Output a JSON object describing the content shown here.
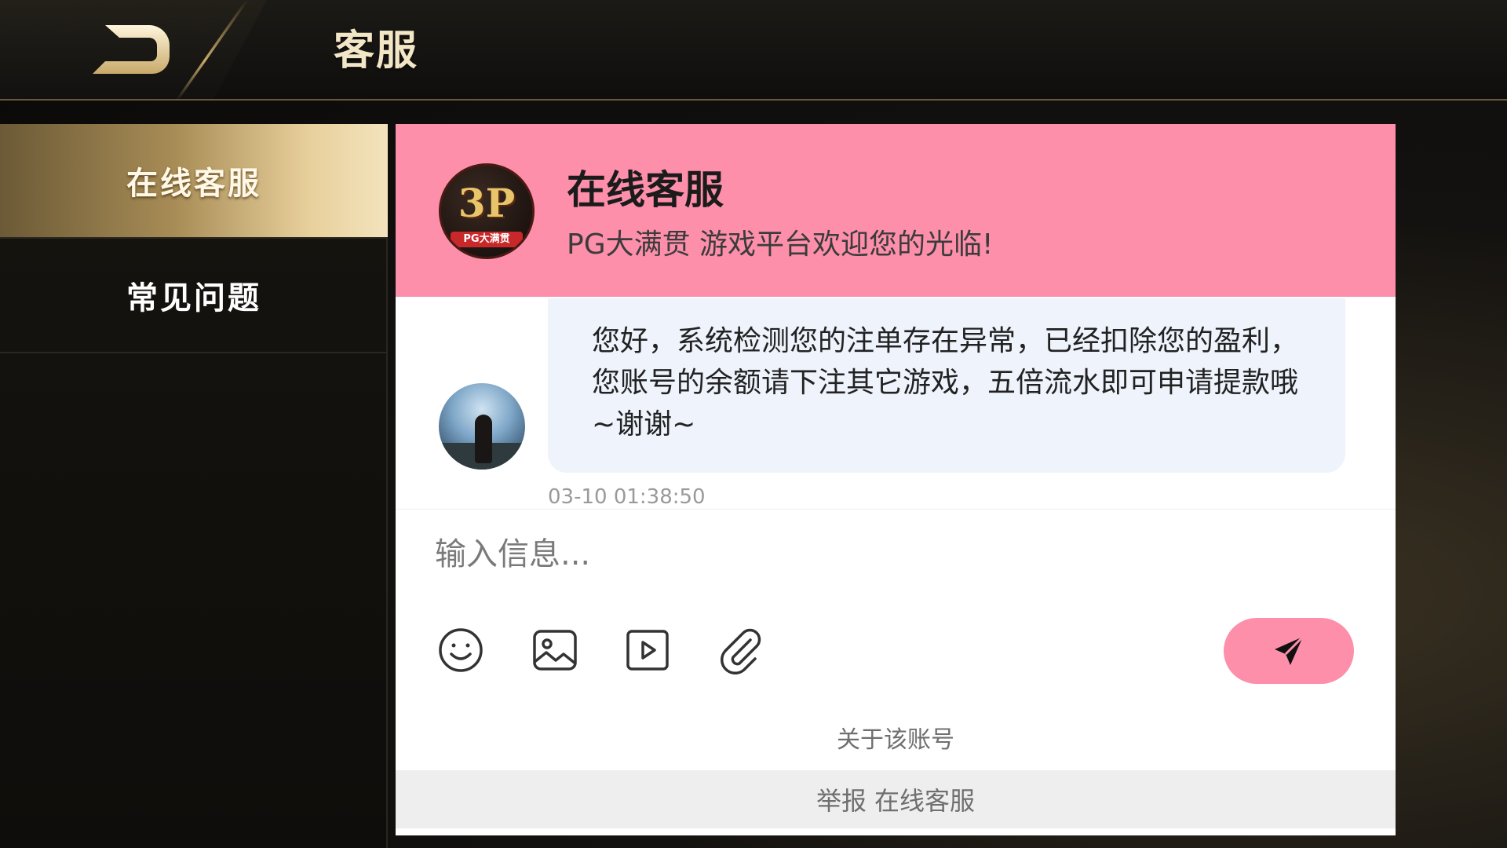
{
  "header": {
    "title": "客服",
    "back_icon": "back-arrow-icon"
  },
  "sidebar": {
    "items": [
      {
        "label": "在线客服",
        "active": true
      },
      {
        "label": "常见问题",
        "active": false
      }
    ]
  },
  "chat": {
    "title": "在线客服",
    "welcome": "PG大满贯 游戏平台欢迎您的光临!",
    "logo": {
      "main_text": "3P",
      "sub_text": "PG大满贯"
    },
    "messages": [
      {
        "text": "您好，系统检测您的注单存在异常，已经扣除您的盈利，您账号的余额请下注其它游戏，五倍流水即可申请提款哦~谢谢~",
        "time": "03-10 01:38:50"
      }
    ],
    "input_placeholder": "输入信息...",
    "tools": [
      "emoji-icon",
      "image-icon",
      "video-icon",
      "attachment-icon"
    ],
    "send_icon": "send-icon",
    "about_label": "关于该账号",
    "report_label": "举报",
    "report_target": "在线客服"
  },
  "colors": {
    "accent_pink": "#fd8fab",
    "bubble_bg": "#eef3fc",
    "gold": "#c9a96a"
  }
}
